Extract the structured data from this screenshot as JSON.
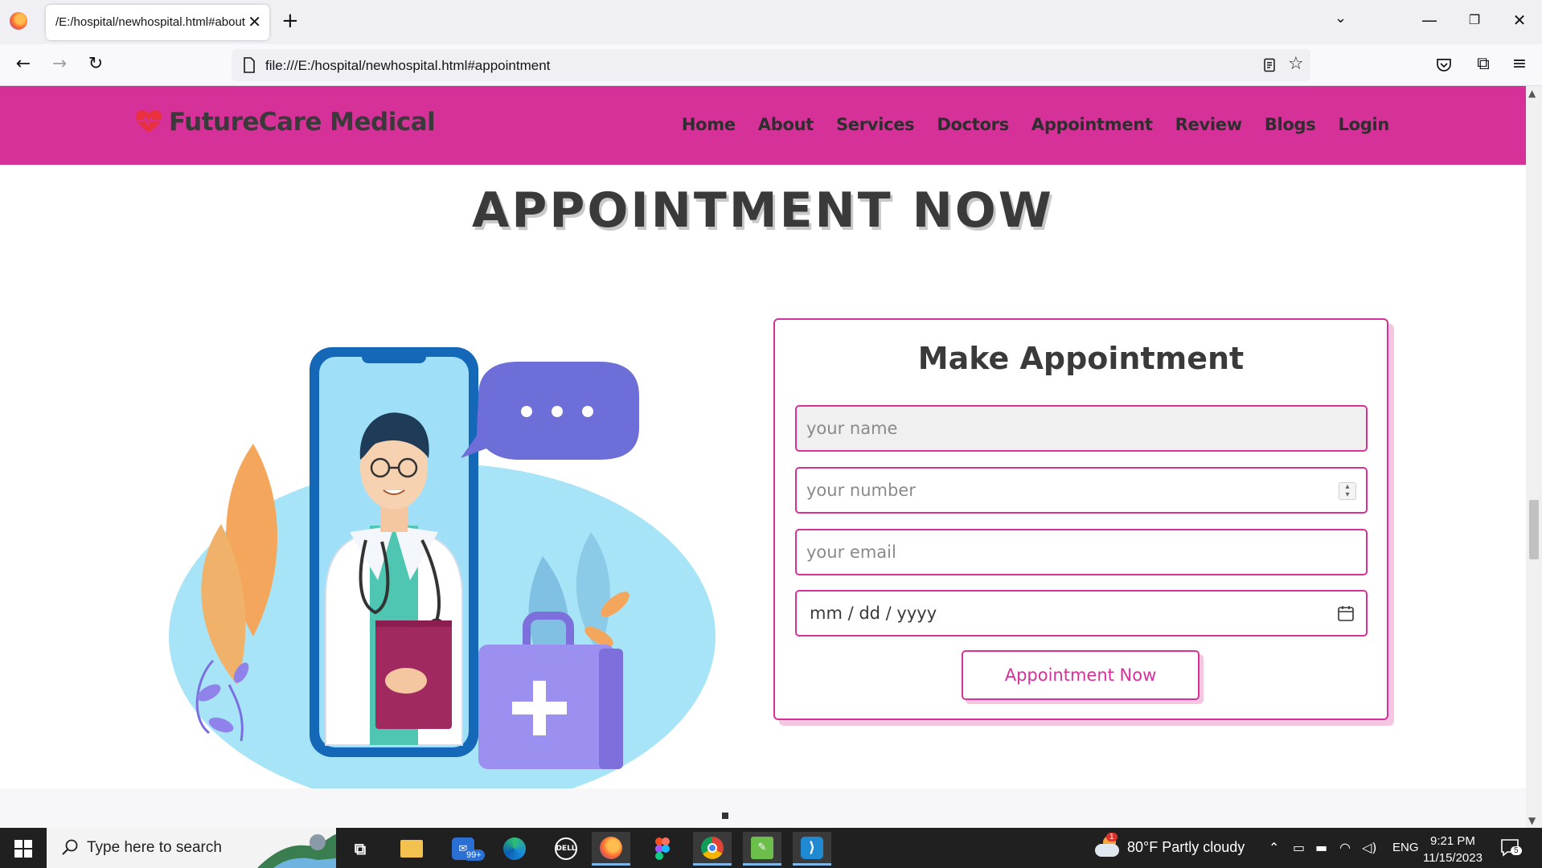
{
  "browser": {
    "tab_title": "/E:/hospital/newhospital.html#about",
    "url": "file:///E:/hospital/newhospital.html#appointment",
    "new_tab_label": "+",
    "close_tab_label": "✕"
  },
  "site": {
    "brand": "FutureCare Medical",
    "nav": [
      {
        "label": "Home"
      },
      {
        "label": "About"
      },
      {
        "label": "Services"
      },
      {
        "label": "Doctors"
      },
      {
        "label": "Appointment"
      },
      {
        "label": "Review"
      },
      {
        "label": "Blogs"
      },
      {
        "label": "Login"
      }
    ],
    "brand_color": "#d63199"
  },
  "section": {
    "heading": "APPOINTMENT NOW"
  },
  "form": {
    "title": "Make Appointment",
    "name_placeholder": "your name",
    "number_placeholder": "your number",
    "email_placeholder": "your email",
    "date_value": "mm / dd / yyyy",
    "submit_label": "Appointment Now"
  },
  "taskbar": {
    "search_placeholder": "Type here to search",
    "mail_badge": "99+",
    "weather": "80°F  Partly cloudy",
    "weather_badge": "1",
    "language": "ENG",
    "time": "9:21 PM",
    "date": "11/15/2023",
    "notifications_count": "5",
    "apps": [
      "task-view",
      "file-explorer",
      "mail",
      "edge",
      "dell",
      "firefox",
      "figma",
      "chrome",
      "notepad",
      "vscode"
    ]
  }
}
